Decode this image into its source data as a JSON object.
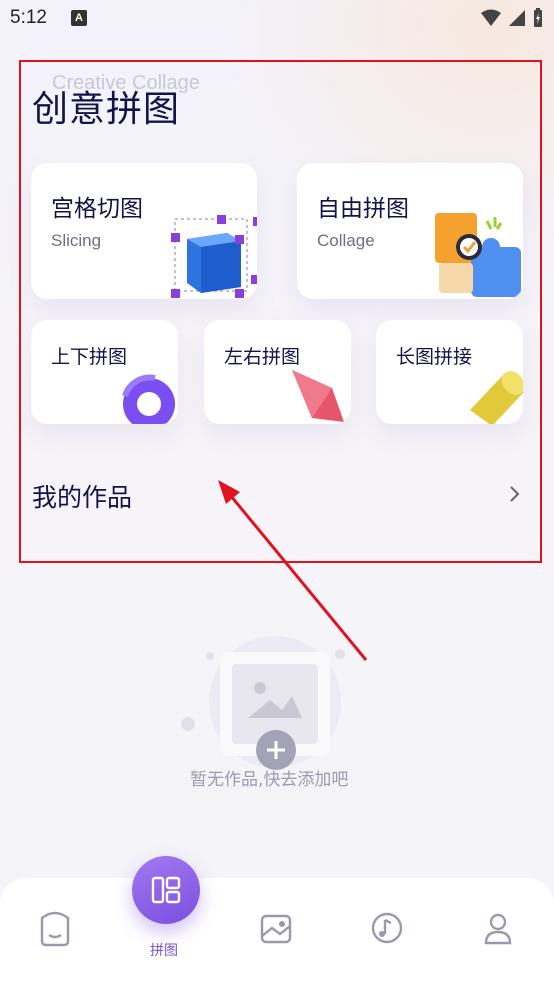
{
  "status_bar": {
    "time": "5:12",
    "notification_badge": "A"
  },
  "header": {
    "ghost_title": "Creative Collage",
    "title": "创意拼图"
  },
  "cards": {
    "slicing": {
      "title": "宫格切图",
      "subtitle": "Slicing"
    },
    "collage": {
      "title": "自由拼图",
      "subtitle": "Collage"
    },
    "vertical": {
      "title": "上下拼图"
    },
    "horizontal": {
      "title": "左右拼图"
    },
    "long": {
      "title": "长图拼接"
    }
  },
  "works": {
    "title": "我的作品"
  },
  "empty_state": {
    "text": "暂无作品,快去添加吧"
  },
  "tabbar": {
    "active_label": "拼图",
    "accent": "#7b4fe0"
  },
  "annotation_color": "#e0121e"
}
